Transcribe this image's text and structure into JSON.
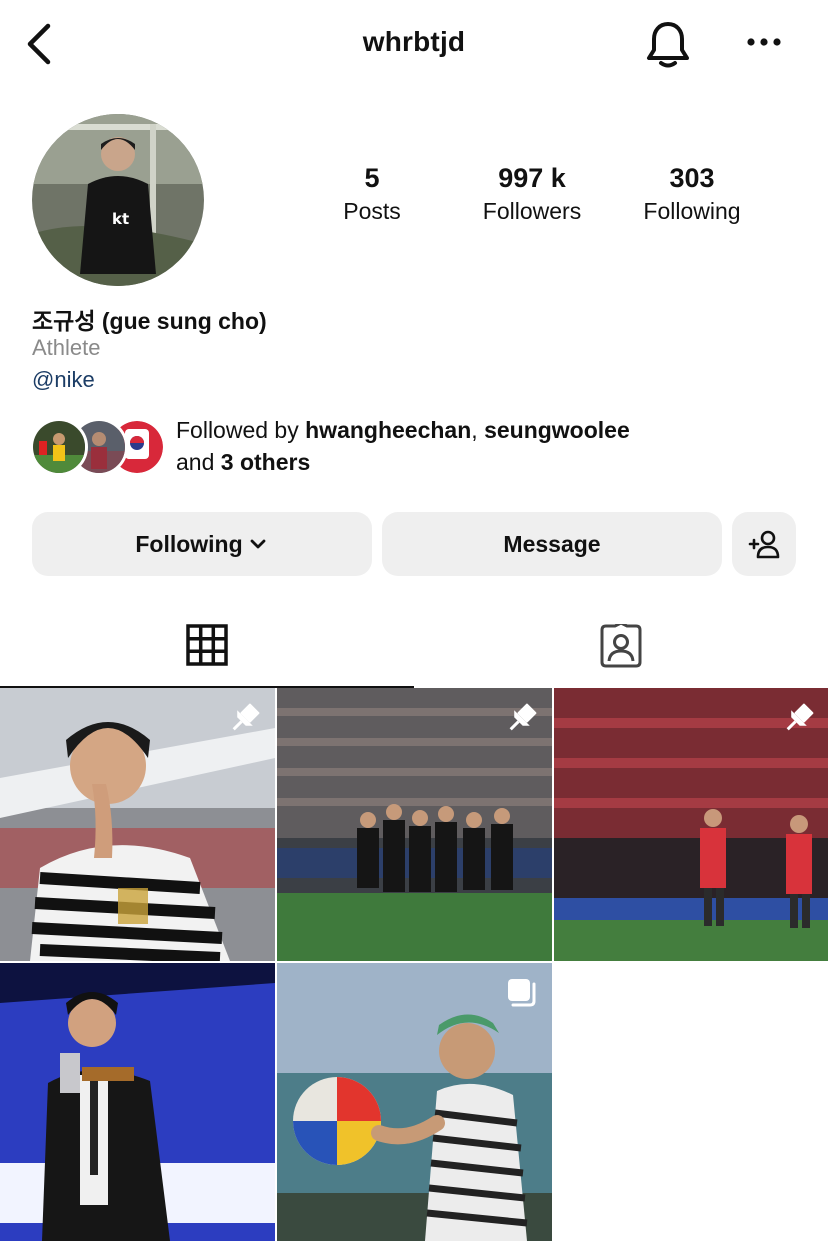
{
  "header": {
    "username": "whrbtjd",
    "back_icon": "chevron-left-icon",
    "notification_icon": "bell-icon",
    "more_icon": "ellipsis-icon"
  },
  "profile": {
    "stats": {
      "posts_count": "5",
      "posts_label": "Posts",
      "followers_count": "997 k",
      "followers_label": "Followers",
      "following_count": "303",
      "following_label": "Following"
    },
    "display_name": "조규성 (gue sung cho)",
    "category": "Athlete",
    "bio_link": "@nike",
    "followed_by": {
      "prefix": "Followed by ",
      "user1": "hwangheechan",
      "separator": ", ",
      "user2": "seungwoolee",
      "and_text": "and ",
      "others": "3 others"
    }
  },
  "actions": {
    "following_label": "Following",
    "message_label": "Message",
    "add_user_icon": "add-person-icon"
  },
  "tabs": {
    "posts_icon": "grid-icon",
    "tagged_icon": "tagged-person-icon"
  },
  "posts": [
    {
      "badge": "pin-icon"
    },
    {
      "badge": "pin-icon"
    },
    {
      "badge": "pin-icon"
    },
    {
      "badge": ""
    },
    {
      "badge": "carousel-icon"
    }
  ],
  "colors": {
    "link": "#1c3d66",
    "button_bg": "#efefef",
    "muted_text": "#8a8a8a"
  }
}
